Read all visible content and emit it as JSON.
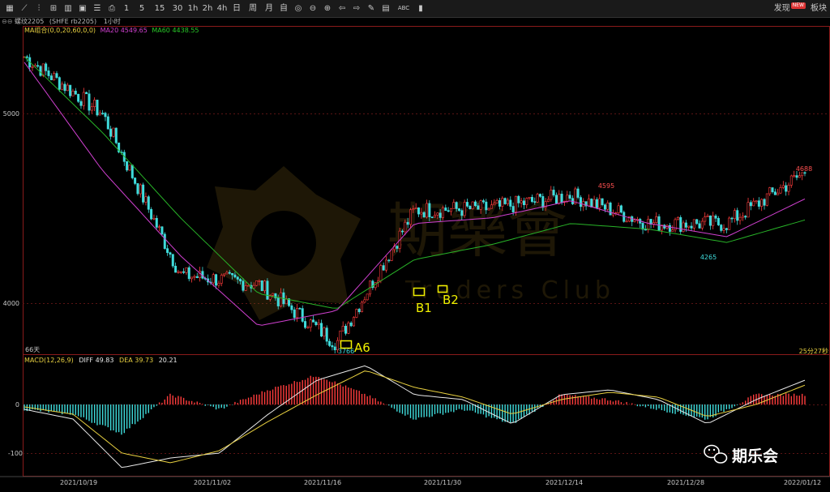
{
  "toolbar": {
    "periods": [
      "1",
      "5",
      "15",
      "30",
      "1h",
      "2h",
      "4h",
      "日",
      "周",
      "月",
      "自"
    ],
    "abc_label": "ABC",
    "discover_label": "发现",
    "new_badge": "NEW",
    "right_label": "板块"
  },
  "infobar": {
    "symbol": "螺纹2205",
    "code": "SHFE rb2205",
    "period": "1小时"
  },
  "ma_legend": {
    "title": "MA组合(0,0,20,60,0,0)",
    "ma20": "MA20 4549.65",
    "ma60": "MA60 4438.55"
  },
  "macd_legend": {
    "title": "MACD(12,26,9)",
    "diff": "DIFF 49.83",
    "dea": "DEA 39.73",
    "macd": "20.21"
  },
  "colors": {
    "up": "#ff3c3c",
    "down": "#3fdcdc",
    "ma20": "#d040d0",
    "ma60": "#28b428",
    "diff": "#e8e8e8",
    "dea": "#e8d040",
    "annot": "#f0f000",
    "frame": "#8a1a1a"
  },
  "main_chart": {
    "ylabels": [
      "5000",
      "4000"
    ],
    "left_note": "66天",
    "right_note": "25分27秒",
    "high_label": "4688",
    "peak_label": "4595",
    "low_label": "3766",
    "low2_label": "4265"
  },
  "macd_chart": {
    "ylabels": [
      "0",
      "-100"
    ]
  },
  "annotations": [
    "A6",
    "B1",
    "B2"
  ],
  "watermark": {
    "text": "期樂會",
    "sub": "Traders Club"
  },
  "logo_badge": "期乐会",
  "chart_data": {
    "type": "line",
    "title": "",
    "xlabel": "",
    "ylabel": "",
    "x": [
      "2021/10/19",
      "2021/11/02",
      "2021/11/16",
      "2021/11/30",
      "2021/12/14",
      "2021/12/28",
      "2022/01/12"
    ],
    "ylim": [
      3700,
      5450
    ],
    "series": [
      {
        "name": "close",
        "values": [
          5300,
          5000,
          4150,
          4100,
          3790,
          4490,
          4500,
          4570,
          4420,
          4420,
          4688
        ]
      },
      {
        "name": "MA20",
        "values": [
          5270,
          4700,
          4250,
          3880,
          3960,
          4420,
          4450,
          4540,
          4420,
          4350,
          4549.65
        ]
      },
      {
        "name": "MA60",
        "values": [
          5300,
          4900,
          4450,
          4050,
          3970,
          4230,
          4310,
          4420,
          4390,
          4320,
          4438.55
        ]
      }
    ],
    "macd": {
      "ylim": [
        -150,
        100
      ],
      "DIFF": 49.83,
      "DEA": 39.73,
      "MACD": 20.21
    }
  }
}
